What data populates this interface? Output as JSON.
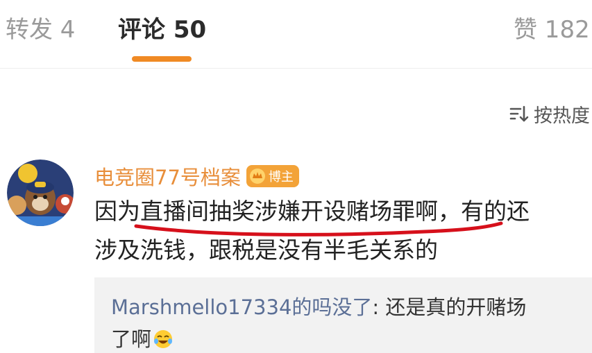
{
  "tabs": {
    "repost": "转发 4",
    "comments": "评论 50",
    "likes": "赞 182"
  },
  "sort": {
    "label": "按热度"
  },
  "comment": {
    "author": "电竞圈77号档案",
    "badge": "博主",
    "line1": "因为直播间抽奖涉嫌开设赌场罪啊，有的还",
    "line2": "涉及洗钱，跟税是没有半毛关系的",
    "reply": {
      "user": "Marshmello17334的吗没了",
      "separator": ": ",
      "text_line1": "还是真的开赌场",
      "text_line2": "了啊"
    }
  },
  "colors": {
    "accent": "#f08a24",
    "author": "#e88e3a",
    "reply_user": "#5b6f96",
    "underline": "#d6101b"
  },
  "icons": {
    "sort": "sort-icon",
    "badge": "crown-icon",
    "emoji": "laughing-emoji-icon"
  }
}
